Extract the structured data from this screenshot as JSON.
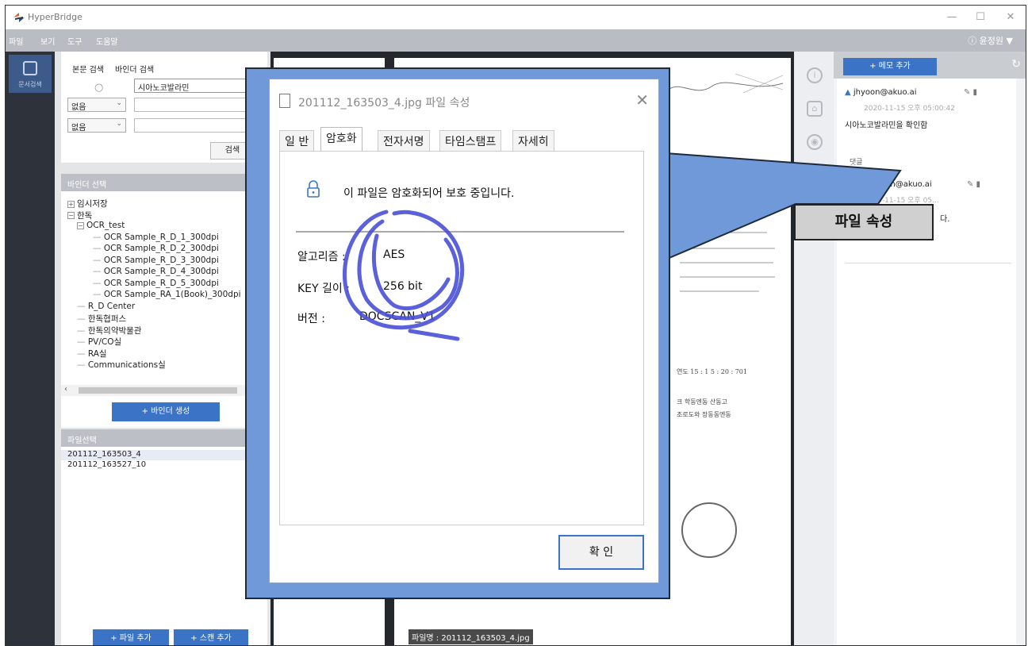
{
  "app": {
    "title": "HyperBridge",
    "window_controls": {
      "minimize": "—",
      "maximize": "☐",
      "close": "✕"
    }
  },
  "menu": {
    "items": [
      "파일",
      "보기",
      "도구",
      "도움말"
    ],
    "user": "ⓘ 윤정원 ▼"
  },
  "rail": {
    "label": "문서검색"
  },
  "search": {
    "tabs": [
      "본문 검색",
      "바인더 검색"
    ],
    "query": "시아노코발라민",
    "filters": [
      "없음",
      "없음"
    ],
    "search_button": "검색"
  },
  "binder": {
    "header": "바인더 선택",
    "tree": [
      {
        "label": "임시저장",
        "level": 0,
        "toggle": "+"
      },
      {
        "label": "한독",
        "level": 0,
        "toggle": "−"
      },
      {
        "label": "OCR_test",
        "level": 1,
        "toggle": "−"
      },
      {
        "label": "OCR Sample_R_D_1_300dpi",
        "level": 2
      },
      {
        "label": "OCR Sample_R_D_2_300dpi",
        "level": 2
      },
      {
        "label": "OCR Sample_R_D_3_300dpi",
        "level": 2
      },
      {
        "label": "OCR Sample_R_D_4_300dpi",
        "level": 2
      },
      {
        "label": "OCR Sample_R_D_5_300dpi",
        "level": 2
      },
      {
        "label": "OCR Sample_RA_1(Book)_300dpi",
        "level": 2
      },
      {
        "label": "R_D Center",
        "level": 1
      },
      {
        "label": "한독협퍼스",
        "level": 1
      },
      {
        "label": "한독의약박물관",
        "level": 1
      },
      {
        "label": "PV/CO실",
        "level": 1
      },
      {
        "label": "RA실",
        "level": 1
      },
      {
        "label": "Communications실",
        "level": 1
      }
    ],
    "create_button": "+ 바인더 생성"
  },
  "files": {
    "header": "파일선택",
    "items": [
      "201112_163503_4",
      "201112_163527_10"
    ],
    "add_file_button": "+ 파일 추가",
    "add_scan_button": "+ 스캔 추가"
  },
  "document": {
    "filename_badge": "파일명 : 201112_163503_4.jpg",
    "lines": [
      "연도 15 : 1 5 : 20 : 701",
      "크 학동엔동 산동고",
      "조로도와 장동동엔동"
    ]
  },
  "memo": {
    "add_button": "+ 메모 추가",
    "author": "jhyoon@akuo.ai",
    "timestamp": "2020-11-15 오후 05:00:42",
    "text": "시아노코발라민을 확인함",
    "comments_label": "댓글",
    "reply_author": "jhyoon@akuo.ai",
    "reply_timestamp": "2020-11-15 오후 05...",
    "reply_text_tail": "다."
  },
  "callout": {
    "label": "파일 속성"
  },
  "dialog": {
    "title": "201112_163503_4.jpg 파일 속성",
    "tabs": [
      "일 반",
      "암호화",
      "전자서명",
      "타임스탬프",
      "자세히"
    ],
    "active_tab": 1,
    "message": "이 파일은 암호화되어 보호 중입니다.",
    "fields": [
      {
        "label": "알고리즘 :",
        "value": "AES"
      },
      {
        "label": "KEY 길이 :",
        "value": "256 bit"
      },
      {
        "label": "버전 :",
        "value": "DOCSCAN_V1"
      }
    ],
    "ok_button": "확 인"
  },
  "colors": {
    "accent": "#3b74c6",
    "dialog_frame": "#6f99d8",
    "scribble": "#4a4fd8"
  }
}
